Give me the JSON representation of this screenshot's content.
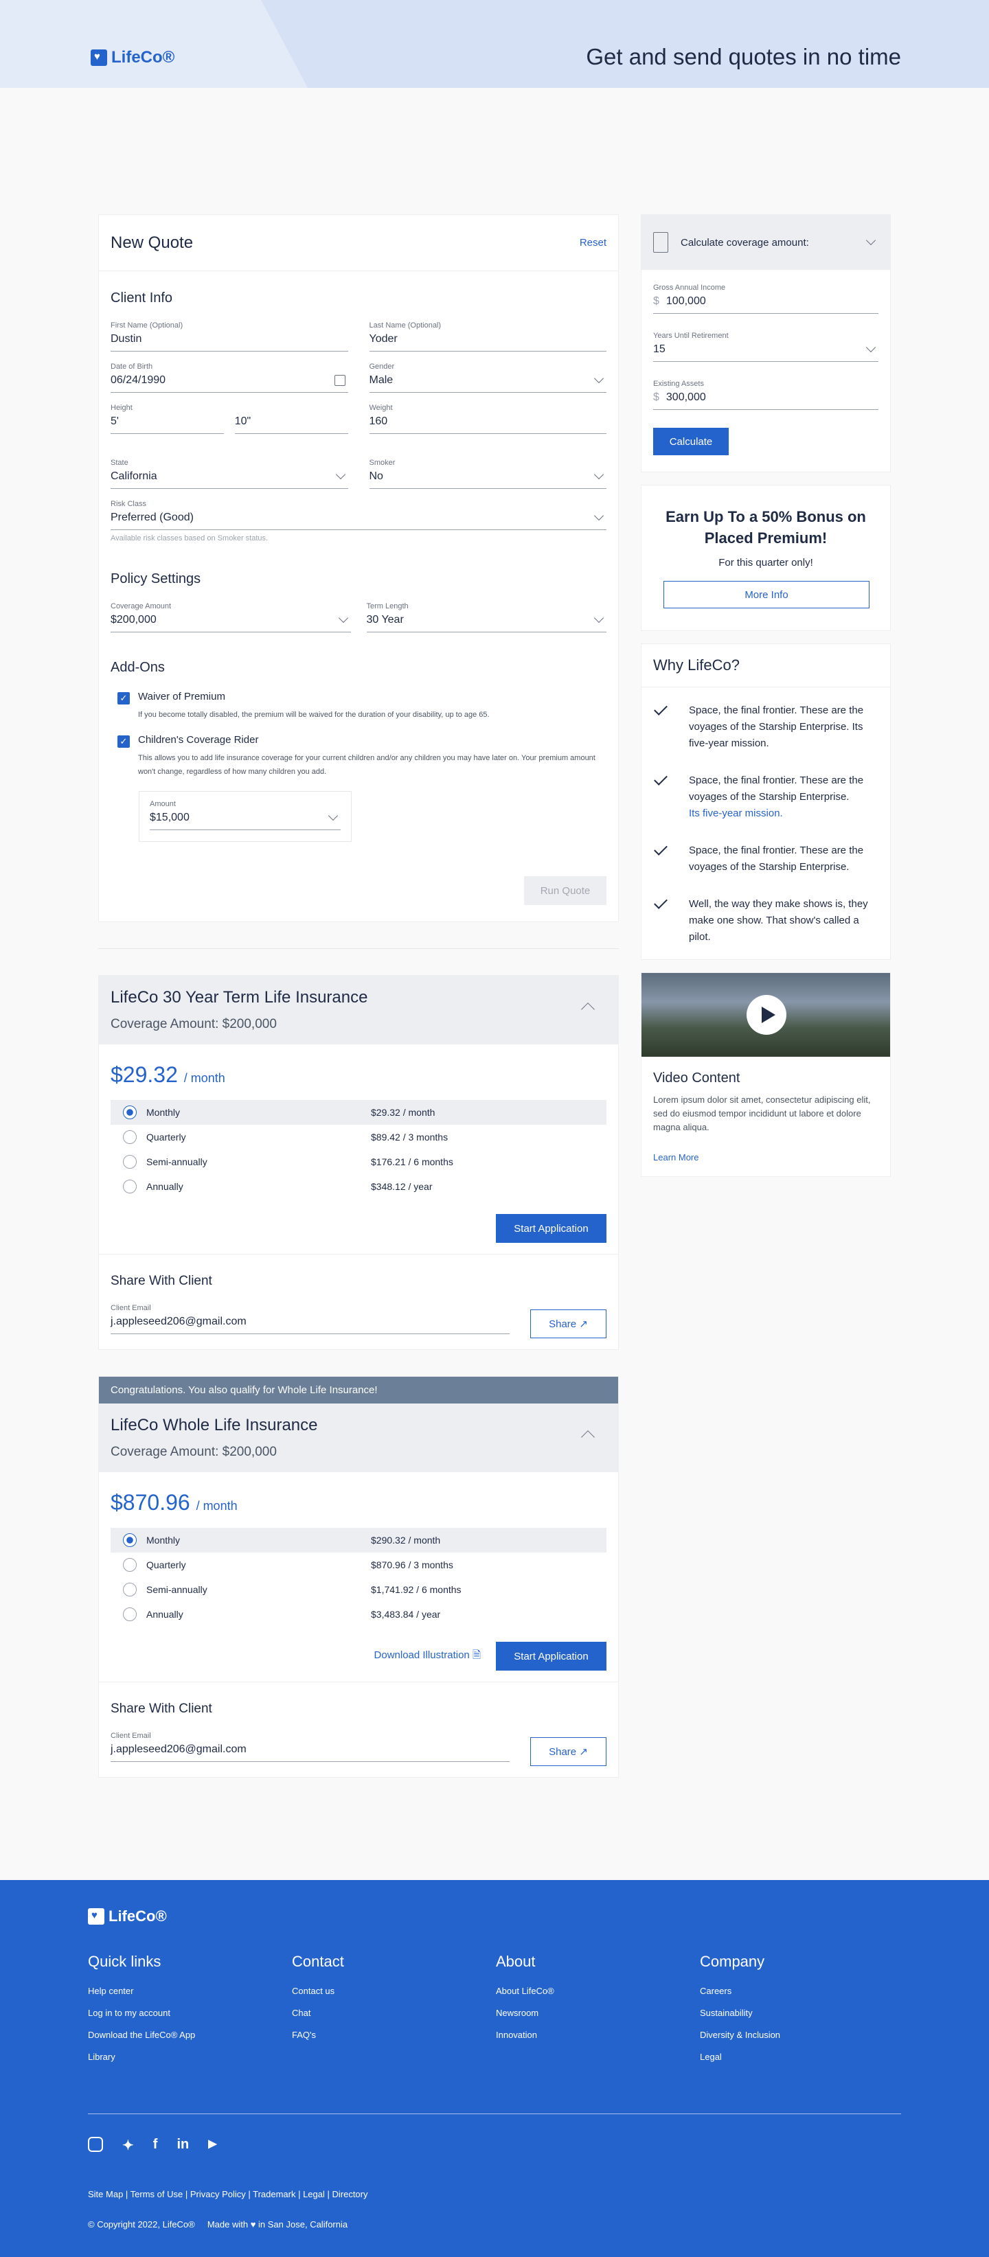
{
  "header": {
    "logo": "LifeCo®",
    "tagline": "Get and send quotes in no time"
  },
  "quote": {
    "title": "New Quote",
    "reset": "Reset",
    "client_info": "Client Info",
    "first_name_label": "First Name (Optional)",
    "first_name": "Dustin",
    "last_name_label": "Last Name (Optional)",
    "last_name": "Yoder",
    "dob_label": "Date of Birth",
    "dob": "06/24/1990",
    "gender_label": "Gender",
    "gender": "Male",
    "height_label": "Height",
    "height_ft": "5'",
    "height_in": "10\"",
    "weight_label": "Weight",
    "weight": "160",
    "state_label": "State",
    "state": "California",
    "smoker_label": "Smoker",
    "smoker": "No",
    "risk_label": "Risk Class",
    "risk": "Preferred (Good)",
    "risk_note": "Available risk classes based on Smoker status.",
    "policy_settings": "Policy Settings",
    "coverage_label": "Coverage Amount",
    "coverage": "$200,000",
    "term_label": "Term Length",
    "term": "30 Year",
    "addons": "Add-Ons",
    "waiver_title": "Waiver of Premium",
    "waiver_desc": "If you become totally disabled, the premium will be waived for the duration of your disability, up to age 65.",
    "child_title": "Children's Coverage Rider",
    "child_desc": "This allows you to add life insurance coverage for your current children and/or any children you may have later on. Your premium amount won't change, regardless of how many children you add.",
    "amount_label": "Amount",
    "amount": "$15,000",
    "run": "Run Quote"
  },
  "term_policy": {
    "title": "LifeCo 30 Year Term Life Insurance",
    "coverage": "Coverage Amount: $200,000",
    "price": "$29.32",
    "per": "/ month",
    "options": [
      {
        "name": "Monthly",
        "value": "$29.32 / month"
      },
      {
        "name": "Quarterly",
        "value": "$89.42 / 3 months"
      },
      {
        "name": "Semi-annually",
        "value": "$176.21 / 6 months"
      },
      {
        "name": "Annually",
        "value": "$348.12 / year"
      }
    ],
    "start": "Start Application",
    "share_title": "Share With Client",
    "email_label": "Client Email",
    "email": "j.appleseed206@gmail.com",
    "share": "Share"
  },
  "whole_policy": {
    "banner": "Congratulations. You also qualify for Whole Life Insurance!",
    "title": "LifeCo Whole Life Insurance",
    "coverage": "Coverage Amount: $200,000",
    "price": "$870.96",
    "per": "/ month",
    "options": [
      {
        "name": "Monthly",
        "value": "$290.32 / month"
      },
      {
        "name": "Quarterly",
        "value": "$870.96 / 3 months"
      },
      {
        "name": "Semi-annually",
        "value": "$1,741.92 / 6 months"
      },
      {
        "name": "Annually",
        "value": "$3,483.84 / year"
      }
    ],
    "download": "Download Illustration",
    "start": "Start Application",
    "share_title": "Share With Client",
    "email_label": "Client Email",
    "email": "j.appleseed206@gmail.com",
    "share": "Share"
  },
  "calc": {
    "title": "Calculate coverage amount:",
    "income_label": "Gross Annual Income",
    "income": "100,000",
    "years_label": "Years Until Retirement",
    "years": "15",
    "assets_label": "Existing Assets",
    "assets": "300,000",
    "currency": "$",
    "button": "Calculate"
  },
  "promo": {
    "title": "Earn Up To a 50% Bonus on Placed Premium!",
    "sub": "For this quarter only!",
    "button": "More Info"
  },
  "why": {
    "title": "Why LifeCo?",
    "items": [
      "Space, the final frontier. These are the voyages of the Starship Enterprise. Its five-year mission.",
      "Space, the final frontier. These are the voyages of the Starship Enterprise.",
      "Its five-year mission.",
      "Space, the final frontier. These are the voyages of the Starship Enterprise.",
      "Well, the way they make shows is, they make one show. That show's called a pilot."
    ]
  },
  "video": {
    "title": "Video Content",
    "desc": "Lorem ipsum dolor sit amet, consectetur adipiscing elit, sed do eiusmod tempor incididunt ut labore et dolore magna aliqua.",
    "link": "Learn More"
  },
  "footer": {
    "logo": "LifeCo®",
    "cols": [
      {
        "title": "Quick links",
        "items": [
          "Help center",
          "Log in to my account",
          "Download the LifeCo® App",
          "Library"
        ]
      },
      {
        "title": "Contact",
        "items": [
          "Contact us",
          "Chat",
          "FAQ's"
        ]
      },
      {
        "title": "About",
        "items": [
          "About LifeCo®",
          "Newsroom",
          "Innovation"
        ]
      },
      {
        "title": "Company",
        "items": [
          "Careers",
          "Sustainability",
          "Diversity & Inclusion",
          "Legal"
        ]
      }
    ],
    "social": [
      "instagram-icon",
      "twitter-icon",
      "facebook-icon",
      "linkedin-icon",
      "youtube-icon"
    ],
    "links": "Site Map | Terms of Use | Privacy Policy | Trademark | Legal | Directory",
    "copyright": "© Copyright 2022, LifeCo®",
    "made_pre": "Made with",
    "made_post": "in San Jose, California"
  },
  "colors": {
    "primary": "#2563cc",
    "header": "#e4ebf8",
    "banner": "#6b7f99"
  }
}
